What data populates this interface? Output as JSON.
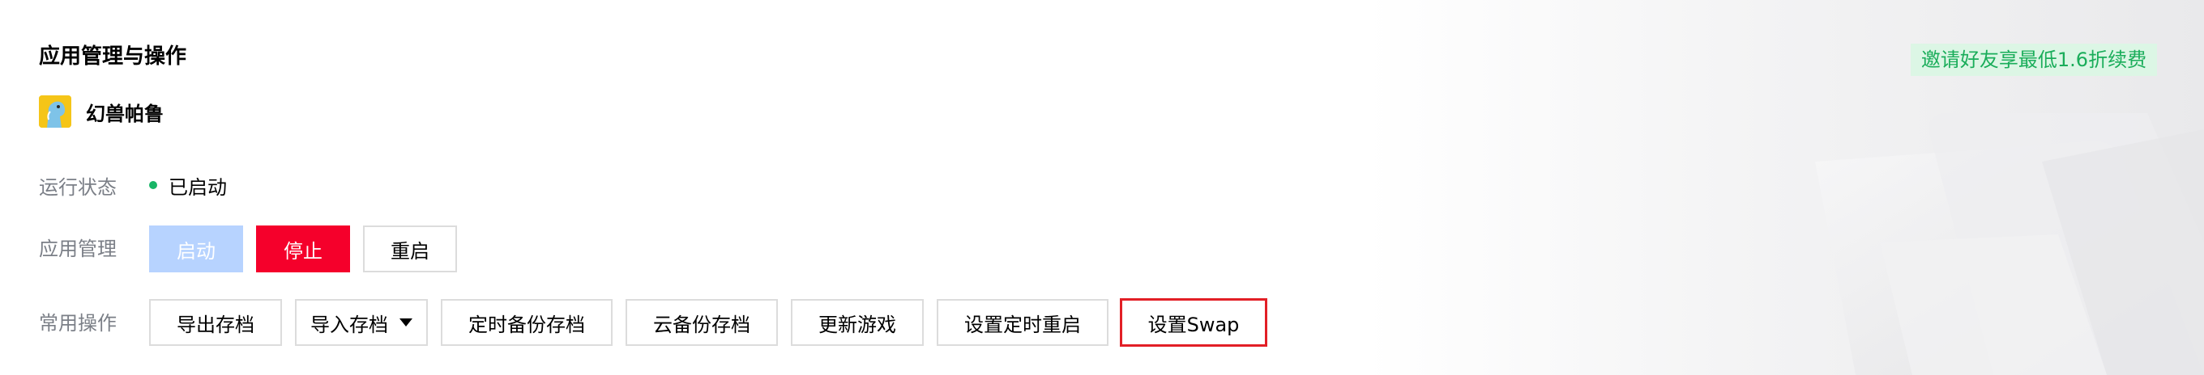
{
  "section_title": "应用管理与操作",
  "app": {
    "name": "幻兽帕鲁",
    "icon": "app-avatar-icon"
  },
  "promo_text": "邀请好友享最低1.6折续费",
  "status": {
    "label": "运行状态",
    "value": "已启动",
    "dot_color": "#18b566"
  },
  "management": {
    "label": "应用管理",
    "start": "启动",
    "stop": "停止",
    "restart": "重启"
  },
  "operations": {
    "label": "常用操作",
    "export_save": "导出存档",
    "import_save": "导入存档",
    "scheduled_backup": "定时备份存档",
    "cloud_backup": "云备份存档",
    "update_game": "更新游戏",
    "scheduled_restart": "设置定时重启",
    "set_swap": "设置Swap"
  },
  "colors": {
    "accent_red": "#f5002b",
    "disabled_blue": "#b7d3ff",
    "promo_green": "#1aad5a"
  }
}
